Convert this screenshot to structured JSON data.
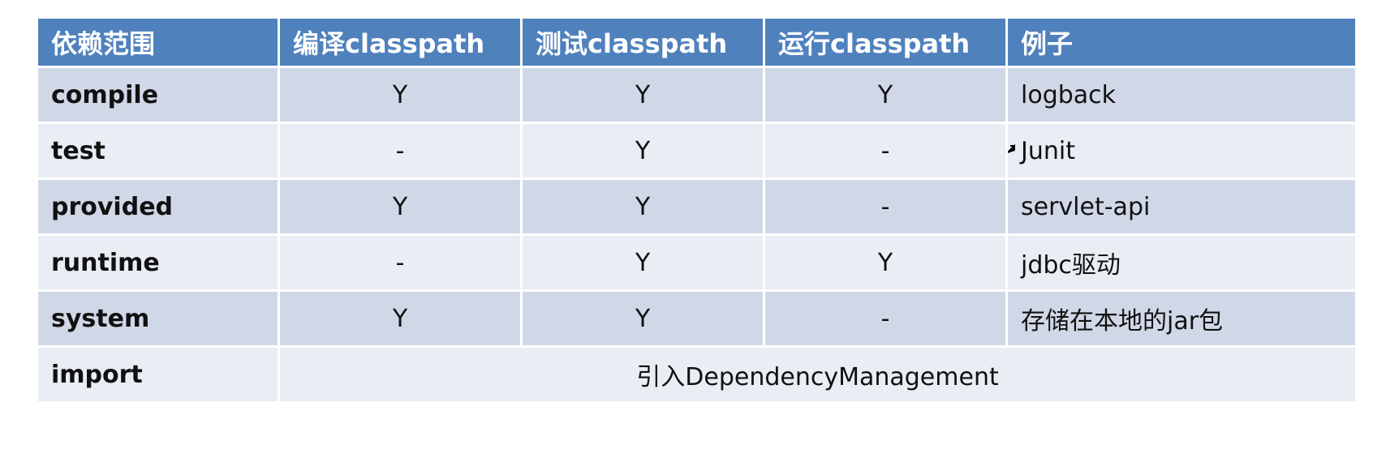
{
  "table": {
    "headers": [
      "依赖范围",
      "编译classpath",
      "测试classpath",
      "运行classpath",
      "例子"
    ],
    "rows": [
      {
        "scope": "compile",
        "compile_cp": "Y",
        "test_cp": "Y",
        "runtime_cp": "Y",
        "example": "logback"
      },
      {
        "scope": "test",
        "compile_cp": "-",
        "test_cp": "Y",
        "runtime_cp": "-",
        "example": "Junit"
      },
      {
        "scope": "provided",
        "compile_cp": "Y",
        "test_cp": "Y",
        "runtime_cp": "-",
        "example": "servlet-api"
      },
      {
        "scope": "runtime",
        "compile_cp": "-",
        "test_cp": "Y",
        "runtime_cp": "Y",
        "example": "jdbc驱动"
      },
      {
        "scope": "system",
        "compile_cp": "Y",
        "test_cp": "Y",
        "runtime_cp": "-",
        "example": "存储在本地的jar包"
      }
    ],
    "import_row": {
      "scope": "import",
      "merged": "引入DependencyManagement"
    }
  },
  "colors": {
    "header_bg": "#4f81bd",
    "row_dark": "#d0d8e8",
    "row_light": "#e9edf4"
  },
  "icons": [
    "mouse-cursor-icon"
  ]
}
